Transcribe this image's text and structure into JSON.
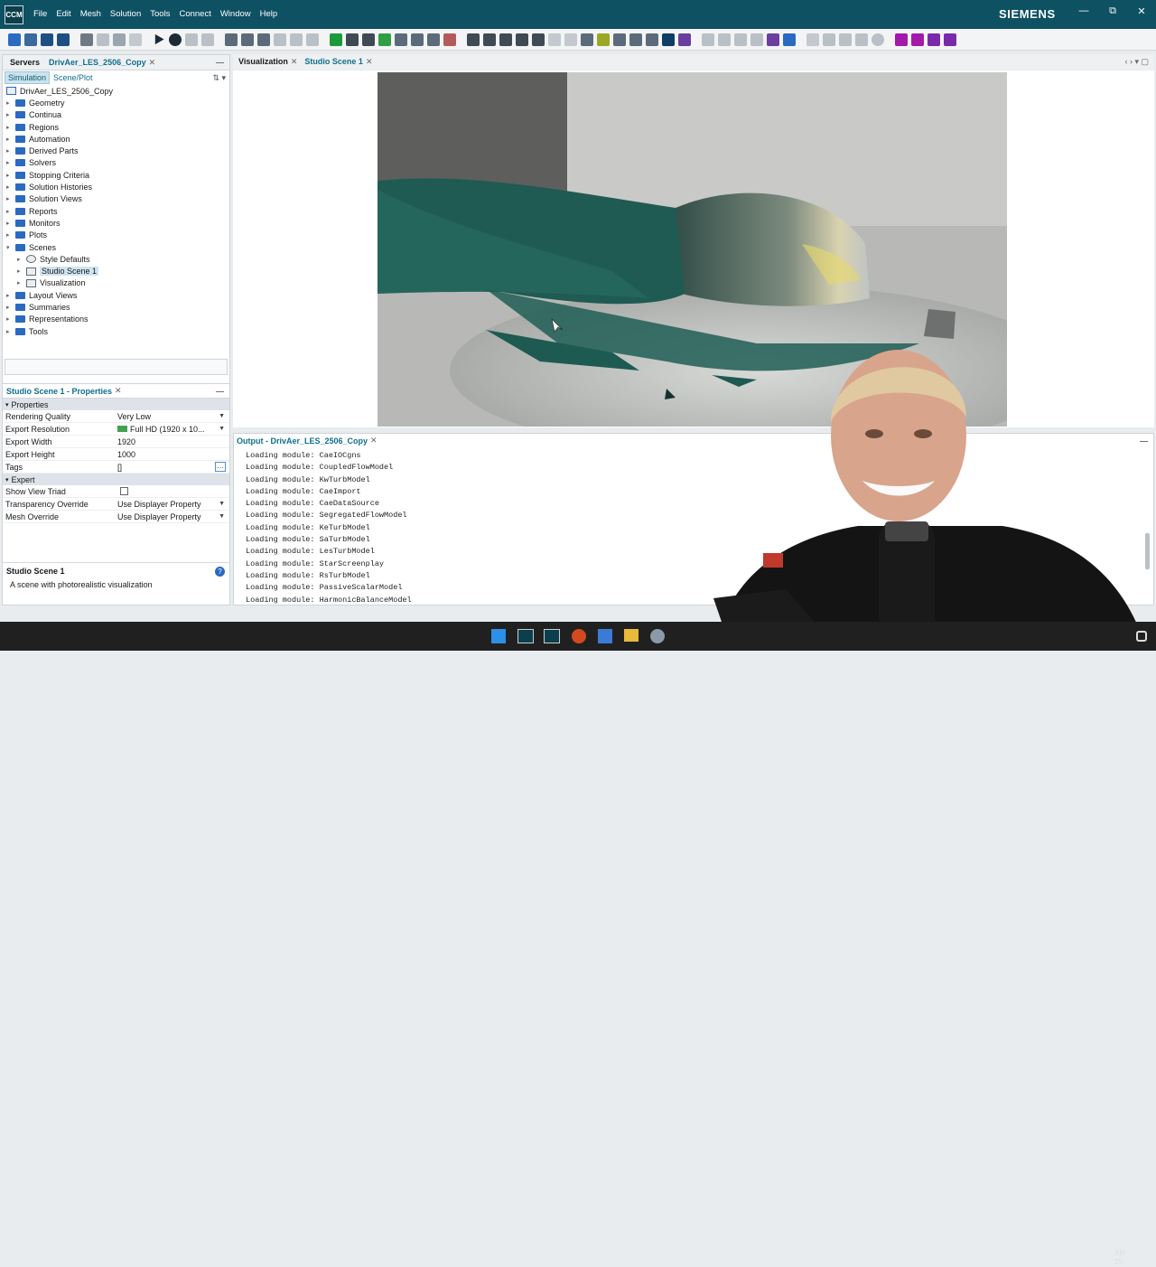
{
  "window": {
    "app_icon": "CCM",
    "brand": "SIEMENS",
    "menu": [
      "File",
      "Edit",
      "Mesh",
      "Solution",
      "Tools",
      "Connect",
      "Window",
      "Help"
    ],
    "controls": [
      "—",
      "⧉",
      "✕"
    ]
  },
  "left_panel": {
    "tabs": [
      "Servers",
      "DrivAer_LES_2506_Copy"
    ],
    "subtabs": [
      "Simulation",
      "Scene/Plot"
    ],
    "tree": {
      "root": "DrivAer_LES_2506_Copy",
      "items": [
        "Geometry",
        "Continua",
        "Regions",
        "Automation",
        "Derived Parts",
        "Solvers",
        "Stopping Criteria",
        "Solution Histories",
        "Solution Views",
        "Reports",
        "Monitors",
        "Plots",
        "Scenes"
      ],
      "scene_children": [
        "Style Defaults",
        "Studio Scene 1",
        "Visualization"
      ],
      "after": [
        "Layout Views",
        "Summaries",
        "Representations",
        "Tools"
      ]
    }
  },
  "properties": {
    "title": "Studio Scene 1 - Properties",
    "section_properties": "Properties",
    "rows": [
      {
        "key": "Rendering Quality",
        "value": "Very Low"
      },
      {
        "key": "Export Resolution",
        "value": "Full HD (1920 x 10..."
      },
      {
        "key": "Export Width",
        "value": "1920"
      },
      {
        "key": "Export Height",
        "value": "1000"
      },
      {
        "key": "Tags",
        "value": "[]"
      }
    ],
    "section_expert": "Expert",
    "expert_rows": [
      {
        "key": "Show View Triad",
        "value": ""
      },
      {
        "key": "Transparency Override",
        "value": "Use Displayer Property"
      },
      {
        "key": "Mesh Override",
        "value": "Use Displayer Property"
      }
    ],
    "description_title": "Studio Scene 1",
    "description_text": "A scene with photorealistic visualization"
  },
  "viz_tabs": [
    "Visualization",
    "Studio Scene 1"
  ],
  "output": {
    "title": "Output - DrivAer_LES_2506_Copy",
    "lines": [
      "Loading module: CaeIOCgns",
      "Loading module: CoupledFlowModel",
      "Loading module: KwTurbModel",
      "Loading module: CaeImport",
      "Loading module: CaeDataSource",
      "Loading module: SegregatedFlowModel",
      "Loading module: KeTurbModel",
      "Loading module: SaTurbModel",
      "Loading module: LesTurbModel",
      "Loading module: StarScreenplay",
      "Loading module: RsTurbModel",
      "Loading module: PassiveScalarModel",
      "Loading module: HarmonicBalanceModel"
    ]
  },
  "taskbar": {
    "clock_time": "AM",
    "clock_date": "25"
  }
}
